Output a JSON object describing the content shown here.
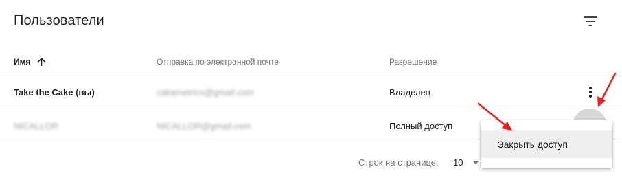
{
  "page": {
    "title": "Пользователи"
  },
  "table": {
    "headers": {
      "name": "Имя",
      "email": "Отправка по электронной почте",
      "permission": "Разрешение"
    },
    "rows": [
      {
        "name": "Take the Cake (вы)",
        "email": "cakametrics@gmail.com",
        "permission": "Владелец"
      },
      {
        "name": "NICALLOR",
        "email": "NICALLOR@gmail.com",
        "permission": "Полный доступ"
      }
    ]
  },
  "pagination": {
    "rows_per_page_label": "Строк на странице:",
    "rows_per_page_value": "10"
  },
  "context_menu": {
    "items": [
      {
        "label": "Закрыть доступ"
      }
    ]
  },
  "icons": {
    "filter": "filter-icon",
    "sort": "arrow-up-icon",
    "more": "more-vert-icon",
    "annotation": "red-arrow"
  },
  "colors": {
    "annotation": "#ee1c1c",
    "divider": "#e0e0e0",
    "menu_hover": "#eeeeee"
  }
}
